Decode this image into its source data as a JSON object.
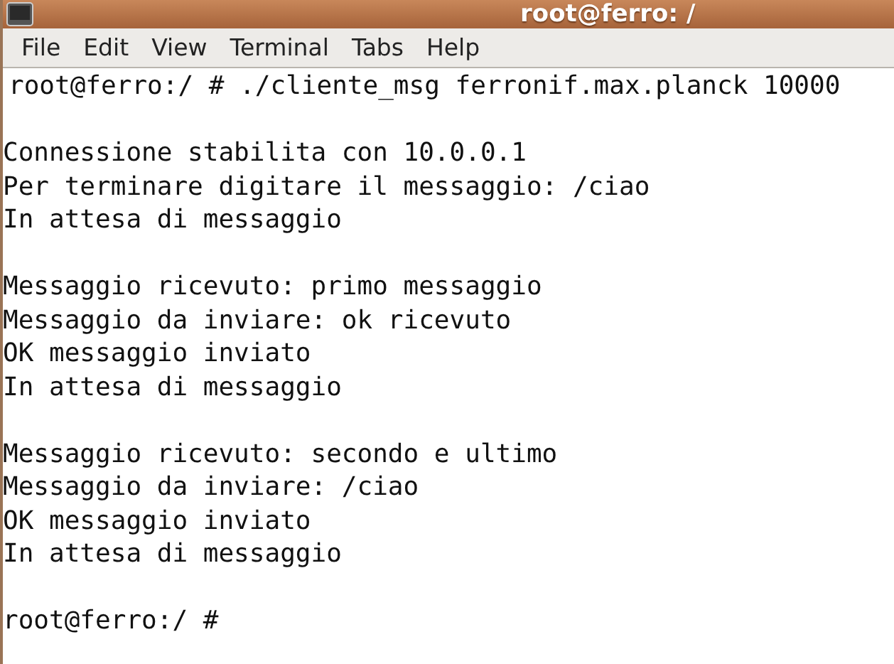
{
  "window": {
    "title": "root@ferro: /"
  },
  "menu": [
    "File",
    "Edit",
    "View",
    "Terminal",
    "Tabs",
    "Help"
  ],
  "terminal": {
    "blocks": [
      [
        "root@ferro:/ # ./cliente_msg ferronif.max.planck 10000"
      ],
      [
        "Connessione stabilita con 10.0.0.1",
        "Per terminare digitare il messaggio: /ciao",
        "In attesa di messaggio"
      ],
      [
        "Messaggio ricevuto: primo messaggio",
        "Messaggio da inviare: ok ricevuto",
        "OK messaggio inviato",
        "In attesa di messaggio"
      ],
      [
        "Messaggio ricevuto: secondo e ultimo",
        "Messaggio da inviare: /ciao",
        "OK messaggio inviato",
        "In attesa di messaggio"
      ],
      [
        "root@ferro:/ #"
      ]
    ]
  }
}
